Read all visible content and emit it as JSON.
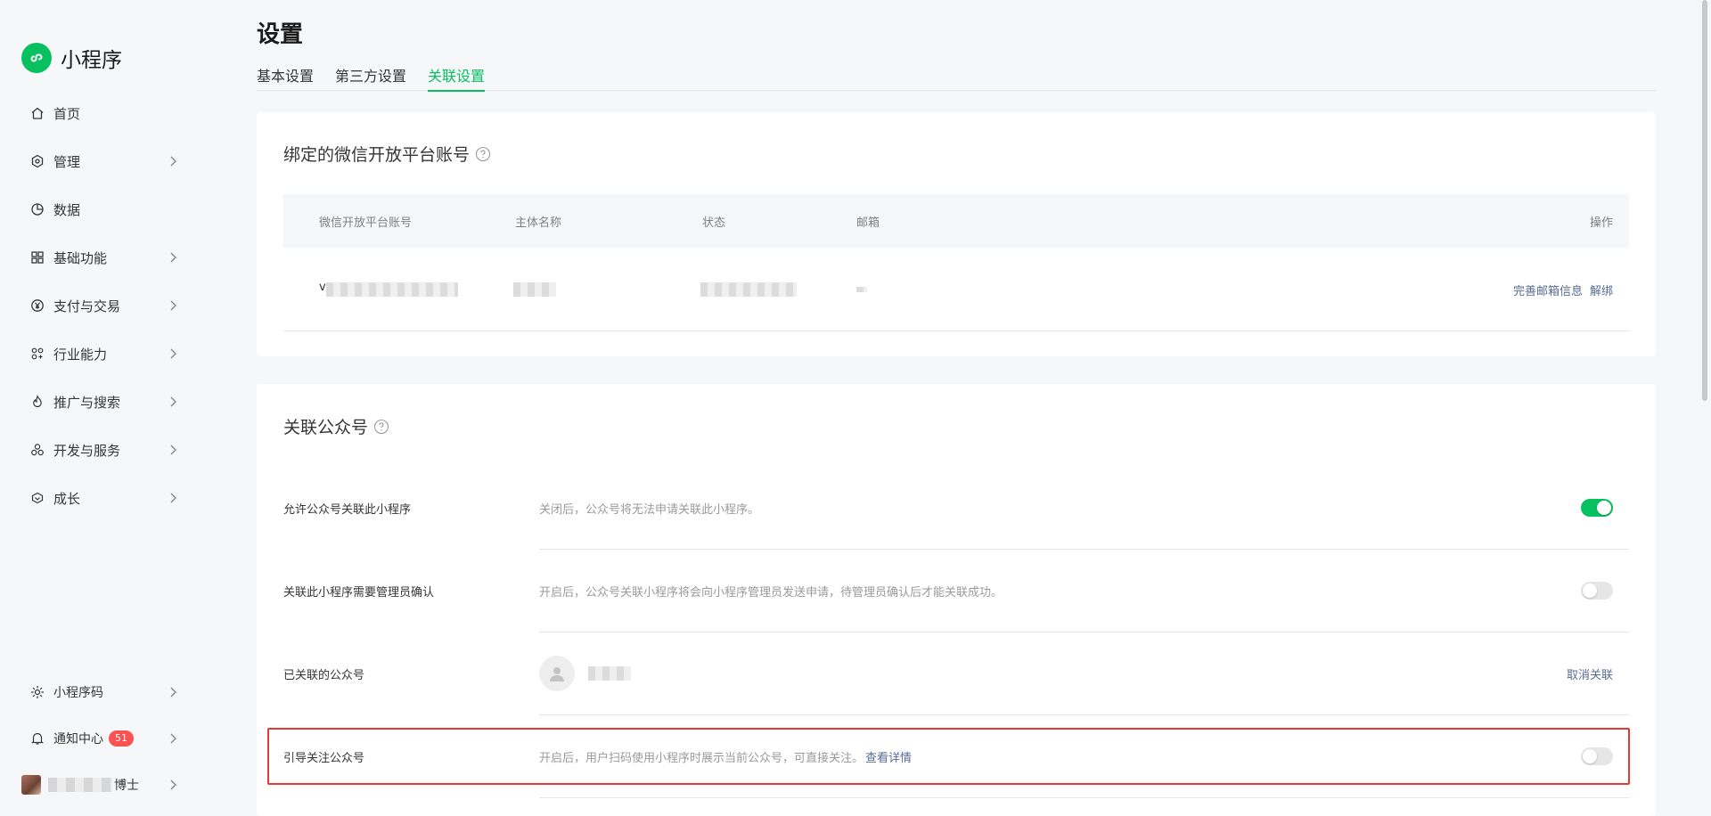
{
  "app": {
    "name": "小程序",
    "brand_color": "#07c160"
  },
  "sidebar": {
    "items": [
      {
        "label": "首页",
        "icon": "home-icon",
        "has_children": false
      },
      {
        "label": "管理",
        "icon": "manage-icon",
        "has_children": true
      },
      {
        "label": "数据",
        "icon": "chart-icon",
        "has_children": false
      },
      {
        "label": "基础功能",
        "icon": "grid-icon",
        "has_children": true
      },
      {
        "label": "支付与交易",
        "icon": "yen-icon",
        "has_children": true
      },
      {
        "label": "行业能力",
        "icon": "industry-icon",
        "has_children": true
      },
      {
        "label": "推广与搜索",
        "icon": "flame-icon",
        "has_children": true
      },
      {
        "label": "开发与服务",
        "icon": "dev-icon",
        "has_children": true
      },
      {
        "label": "成长",
        "icon": "growth-icon",
        "has_children": true
      }
    ],
    "bottom": {
      "qrcode_label": "小程序码",
      "notify_label": "通知中心",
      "notify_count": "51",
      "user_name_suffix": "博士"
    }
  },
  "page": {
    "title": "设置",
    "tabs": [
      {
        "label": "基本设置",
        "active": false
      },
      {
        "label": "第三方设置",
        "active": false
      },
      {
        "label": "关联设置",
        "active": true
      }
    ]
  },
  "open_platform": {
    "title": "绑定的微信开放平台账号",
    "columns": [
      "微信开放平台账号",
      "主体名称",
      "状态",
      "邮箱",
      "操作"
    ],
    "row": {
      "account_prefix": "v",
      "actions": [
        "完善邮箱信息",
        "解绑"
      ]
    }
  },
  "official_account": {
    "title": "关联公众号",
    "rows": [
      {
        "label": "允许公众号关联此小程序",
        "desc": "关闭后，公众号将无法申请关联此小程序。",
        "toggle": true
      },
      {
        "label": "关联此小程序需要管理员确认",
        "desc": "开启后，公众号关联小程序将会向小程序管理员发送申请，待管理员确认后才能关联成功。",
        "toggle": false
      },
      {
        "label": "已关联的公众号",
        "action": "取消关联"
      },
      {
        "label": "引导关注公众号",
        "desc": "开启后，用户扫码使用小程序时展示当前公众号，可直接关注。",
        "link": "查看详情",
        "toggle": false
      }
    ]
  }
}
